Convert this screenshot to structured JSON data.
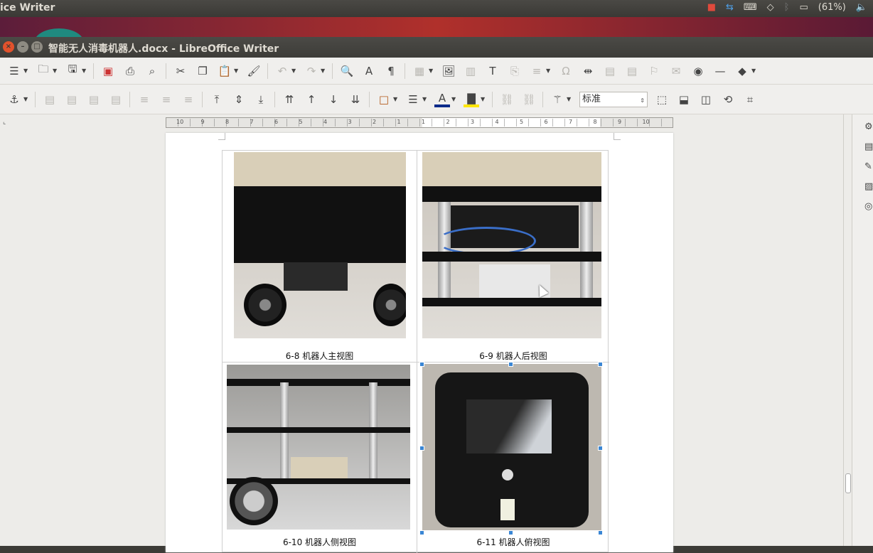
{
  "top_panel": {
    "app_title": "ice Writer",
    "battery": "(61%)"
  },
  "window": {
    "title": "智能无人消毒机器人.docx - LibreOffice Writer"
  },
  "toolbar": {
    "paragraph_style": "标准"
  },
  "document": {
    "captions": [
      "6-8 机器人主视图",
      "6-9 机器人后视图",
      "6-10 机器人侧视图",
      "6-11 机器人俯视图"
    ]
  },
  "colors": {
    "font_color_bar": "#0a2a8a",
    "highlight_bar": "#ffe600",
    "selection_handle": "#3a86d4"
  },
  "ruler": {
    "labels": [
      "10",
      "9",
      "8",
      "7",
      "6",
      "5",
      "4",
      "3",
      "2",
      "1",
      "1",
      "2",
      "3",
      "4",
      "5",
      "6",
      "7",
      "8",
      "9",
      "10"
    ]
  }
}
